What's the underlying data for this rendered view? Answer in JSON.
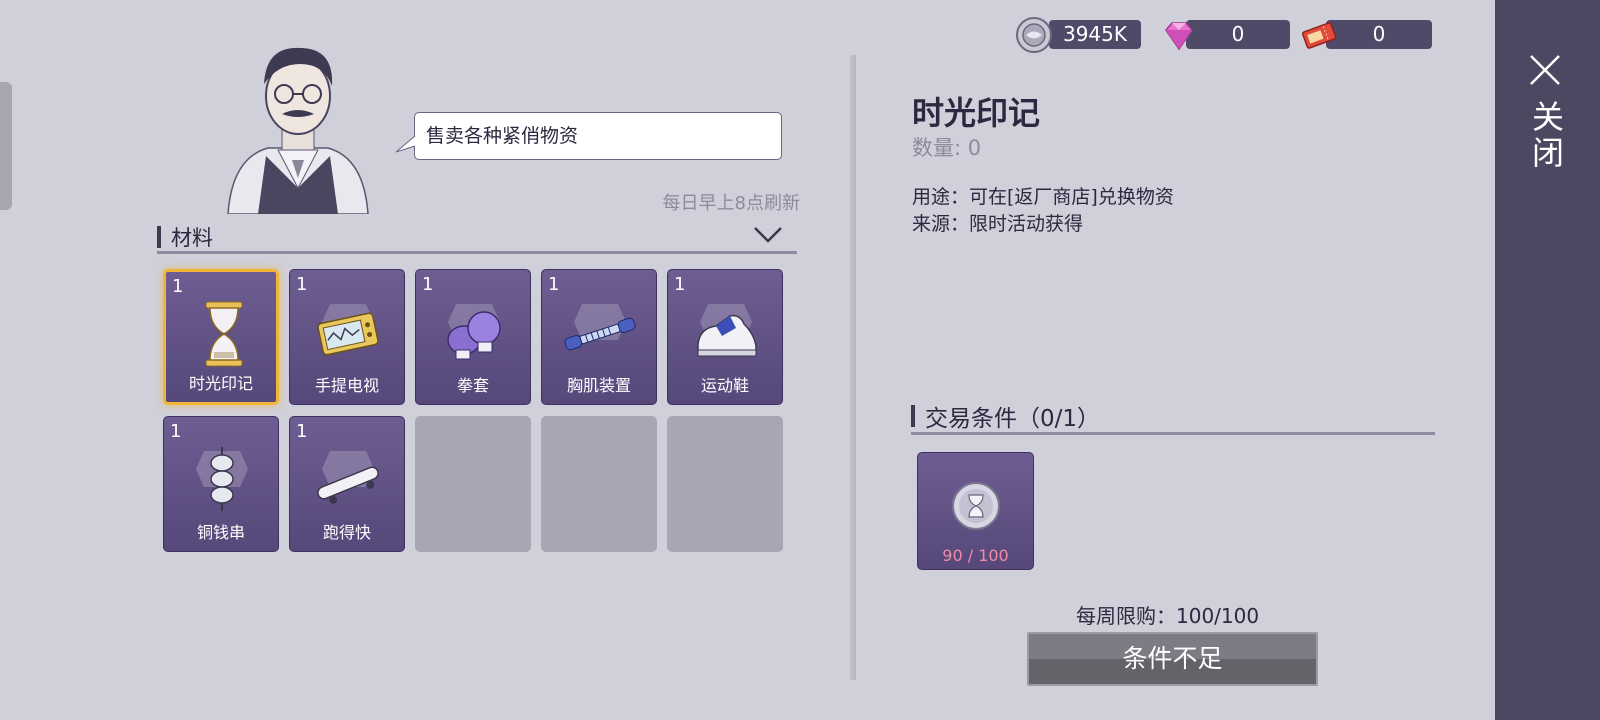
{
  "currencies": [
    {
      "name": "coin",
      "value": "3945K",
      "icon": "silver-coin-icon"
    },
    {
      "name": "gem",
      "value": "0",
      "icon": "pink-gem-icon"
    },
    {
      "name": "ticket",
      "value": "0",
      "icon": "red-ticket-icon"
    }
  ],
  "close": {
    "label": "关闭"
  },
  "merchant": {
    "speech": "售卖各种紧俏物资",
    "refresh_note": "每日早上8点刷新"
  },
  "category": {
    "label": "材料"
  },
  "items": [
    {
      "qty": "1",
      "name": "时光印记",
      "icon": "hourglass-icon",
      "selected": true
    },
    {
      "qty": "1",
      "name": "手提电视",
      "icon": "portable-tv-icon"
    },
    {
      "qty": "1",
      "name": "拳套",
      "icon": "boxing-glove-icon"
    },
    {
      "qty": "1",
      "name": "胸肌装置",
      "icon": "chest-expander-icon"
    },
    {
      "qty": "1",
      "name": "运动鞋",
      "icon": "sneaker-icon"
    },
    {
      "qty": "1",
      "name": "铜钱串",
      "icon": "coin-string-icon"
    },
    {
      "qty": "1",
      "name": "跑得快",
      "icon": "skateboard-icon"
    }
  ],
  "empty_slots": 3,
  "detail": {
    "title": "时光印记",
    "count": "数量: 0",
    "use": "用途：可在[返厂商店]兑换物资",
    "source": "来源：限时活动获得"
  },
  "trade": {
    "label": "交易条件（0/1）",
    "requirement": {
      "progress": "90 / 100",
      "icon": "hourglass-coin-icon"
    },
    "weekly_limit": "每周限购：100/100",
    "button": "条件不足"
  },
  "colors": {
    "accent": "#f2b636",
    "panel": "#4b4862",
    "slot": "#6e5d92",
    "progress": "#f08aa8"
  }
}
